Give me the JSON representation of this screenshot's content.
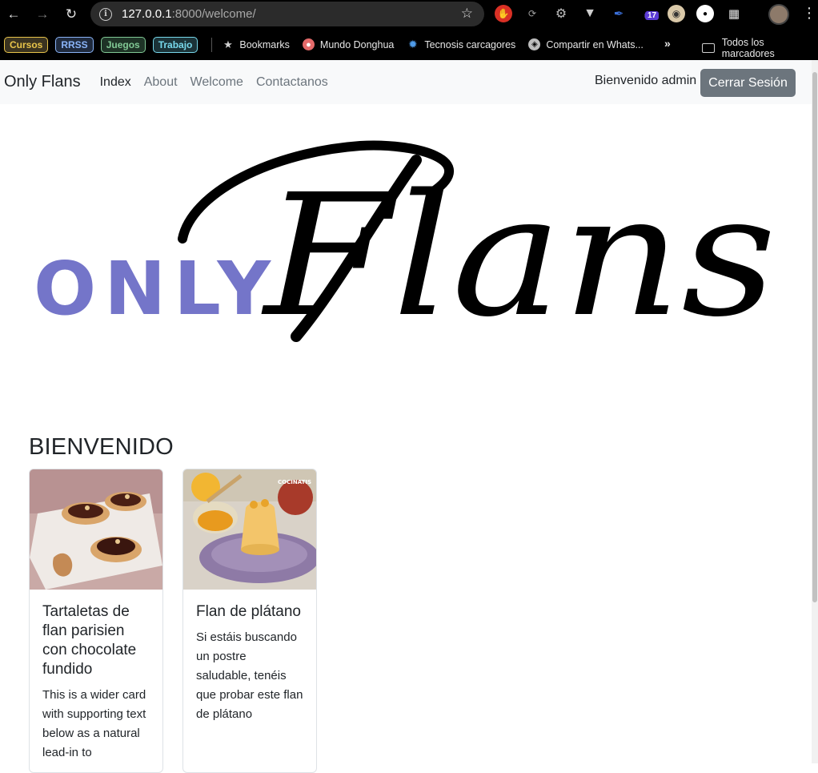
{
  "browser": {
    "url_host": "127.0.0.1",
    "url_path": ":8000/welcome/",
    "extension_badge": "17"
  },
  "bookmarks": {
    "folders": [
      {
        "label": "Cursos",
        "color": "#e8c44a"
      },
      {
        "label": "RRSS",
        "color": "#8ab4f8"
      },
      {
        "label": "Juegos",
        "color": "#81c995"
      },
      {
        "label": "Trabajo",
        "color": "#78d9ec"
      }
    ],
    "items": [
      {
        "label": "Bookmarks"
      },
      {
        "label": "Mundo Donghua"
      },
      {
        "label": "Tecnosis carcagores"
      },
      {
        "label": "Compartir en Whats..."
      }
    ],
    "all_label": "Todos los marcadores"
  },
  "navbar": {
    "brand": "Only Flans",
    "links": [
      "Index",
      "About",
      "Welcome",
      "Contactanos"
    ],
    "welcome_text": "Bienvenido admin",
    "logout_label": "Cerrar Sesión"
  },
  "hero": {
    "logo_small": "ONLY",
    "logo_script": "Flans",
    "small_color": "#7475c9"
  },
  "main": {
    "heading": "BIENVENIDO",
    "cards": [
      {
        "title": "Tartaletas de flan parisien con chocolate fundido",
        "text": "This is a wider card with supporting text below as a natural lead-in to"
      },
      {
        "title": "Flan de plátano",
        "text": "Si estáis buscando un postre saludable, tenéis que probar este flan de plátano",
        "image_watermark": "COCINATIS"
      }
    ]
  }
}
